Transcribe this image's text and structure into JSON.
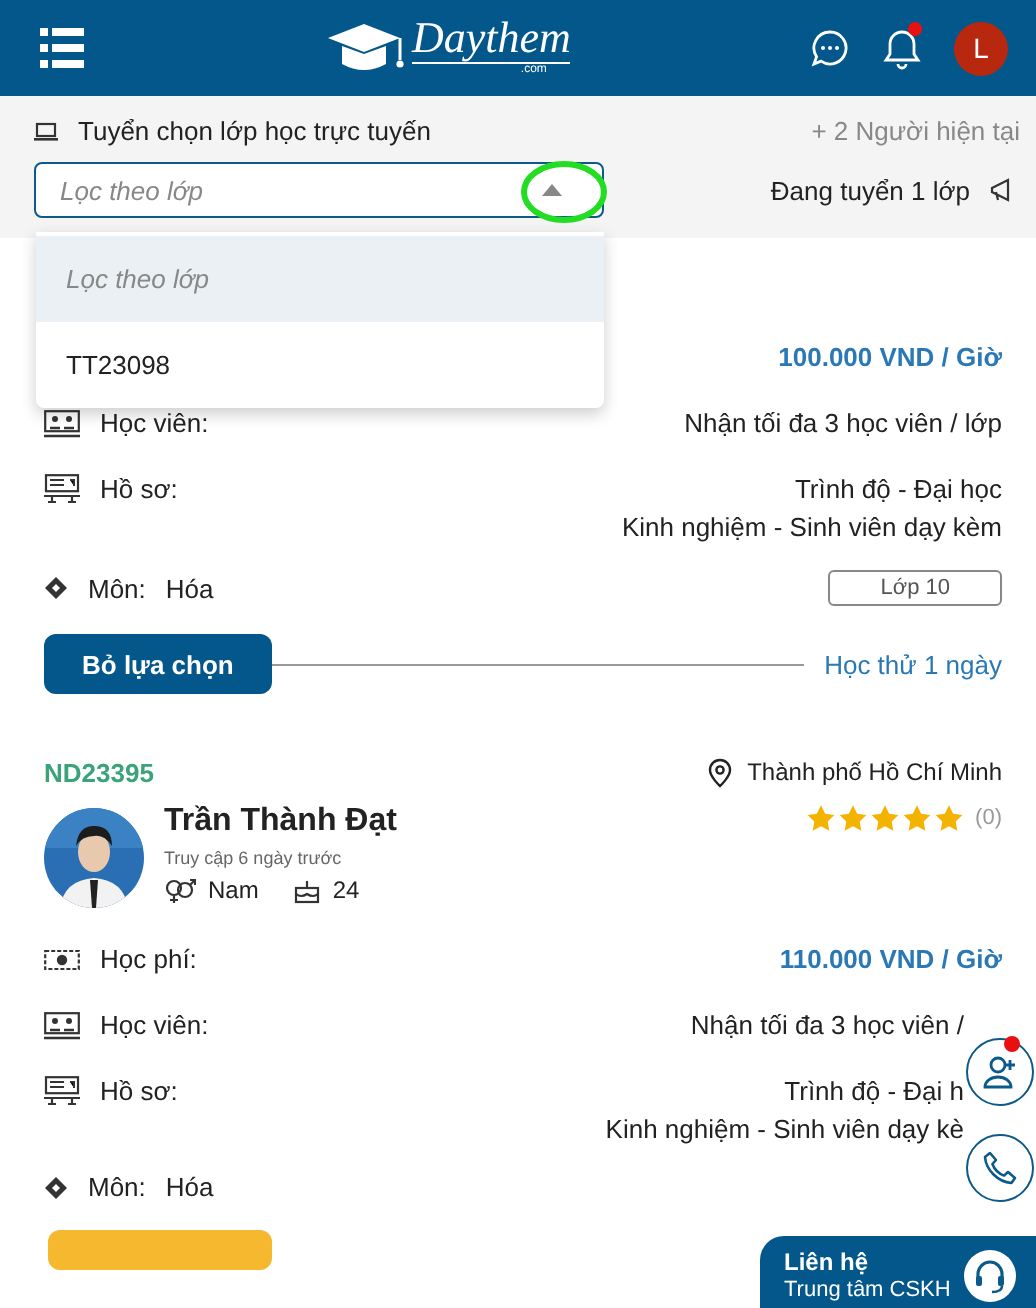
{
  "header": {
    "logo_text": "Daythem",
    "logo_sub": ".com",
    "avatar_letter": "L",
    "notification_dot": true
  },
  "filter": {
    "title": "Tuyển chọn lớp học trực tuyến",
    "online": "+ 2 Người hiện tại",
    "select": {
      "placeholder": "Lọc theo lớp",
      "expanded": true
    },
    "recruiting": "Đang tuyển 1 lớp"
  },
  "dropdown": [
    {
      "label": "Lọc theo lớp",
      "kind": "placeholder",
      "selected": true
    },
    {
      "label": "TT23098",
      "kind": "option",
      "selected": false
    }
  ],
  "cards": [
    {
      "rows": [
        {
          "kind": "fee",
          "value": "100.000 VND / Giờ"
        },
        {
          "kind": "students",
          "label": "Học viên:",
          "lines": [
            "Nhận tối đa 3 học viên / lớp"
          ]
        },
        {
          "kind": "profile",
          "label": "Hồ sơ:",
          "lines": [
            "Trình độ - Đại học",
            "Kinh nghiệm - Sinh viên dạy kèm"
          ]
        }
      ],
      "subject": {
        "label": "Môn:",
        "value": "Hóa",
        "grade": "Lớp 10"
      },
      "action": {
        "kind": "deselect",
        "button": "Bỏ lựa chọn",
        "trial": "Học thử 1 ngày"
      }
    },
    {
      "id": "ND23395",
      "location": "Thành phố Hồ Chí Minh",
      "name": "Trần Thành Đạt",
      "last_seen": "Truy cập 6 ngày trước",
      "gender": "Nam",
      "age": "24",
      "stars": 5,
      "reviews": "(0)",
      "rows": [
        {
          "kind": "fee",
          "label": "Học phí:",
          "lines": [
            "110.000 VND / Giờ"
          ]
        },
        {
          "kind": "students",
          "label": "Học viên:",
          "lines": [
            "Nhận tối đa 3 học viên /"
          ]
        },
        {
          "kind": "profile",
          "label": "Hồ sơ:",
          "lines": [
            "Trình độ - Đại h",
            "Kinh nghiệm - Sinh viên dạy kè"
          ]
        }
      ],
      "subject": {
        "label": "Môn:",
        "value": "Hóa"
      },
      "action": {
        "kind": "cut-off"
      }
    }
  ],
  "floating": {
    "add_dot": true,
    "contact_title": "Liên hệ",
    "contact_subtitle": "Trung tâm CSKH"
  }
}
